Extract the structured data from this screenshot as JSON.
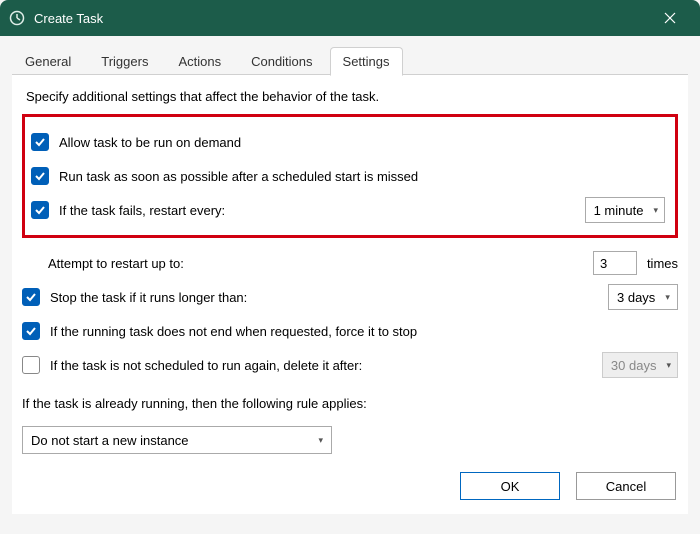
{
  "window": {
    "title": "Create Task"
  },
  "tabs": {
    "general": "General",
    "triggers": "Triggers",
    "actions": "Actions",
    "conditions": "Conditions",
    "settings": "Settings"
  },
  "description": "Specify additional settings that affect the behavior of the task.",
  "settings": {
    "allow_on_demand": {
      "label": "Allow task to be run on demand",
      "checked": true
    },
    "run_asap": {
      "label": "Run task as soon as possible after a scheduled start is missed",
      "checked": true
    },
    "restart_every": {
      "label": "If the task fails, restart every:",
      "checked": true,
      "value": "1 minute"
    },
    "attempt_restart": {
      "label": "Attempt to restart up to:",
      "value": "3",
      "suffix": "times"
    },
    "stop_longer": {
      "label": "Stop the task if it runs longer than:",
      "checked": true,
      "value": "3 days"
    },
    "force_stop": {
      "label": "If the running task does not end when requested, force it to stop",
      "checked": true
    },
    "delete_after": {
      "label": "If the task is not scheduled to run again, delete it after:",
      "checked": false,
      "value": "30 days"
    },
    "running_rule": {
      "label": "If the task is already running, then the following rule applies:",
      "value": "Do not start a new instance"
    }
  },
  "buttons": {
    "ok": "OK",
    "cancel": "Cancel"
  }
}
